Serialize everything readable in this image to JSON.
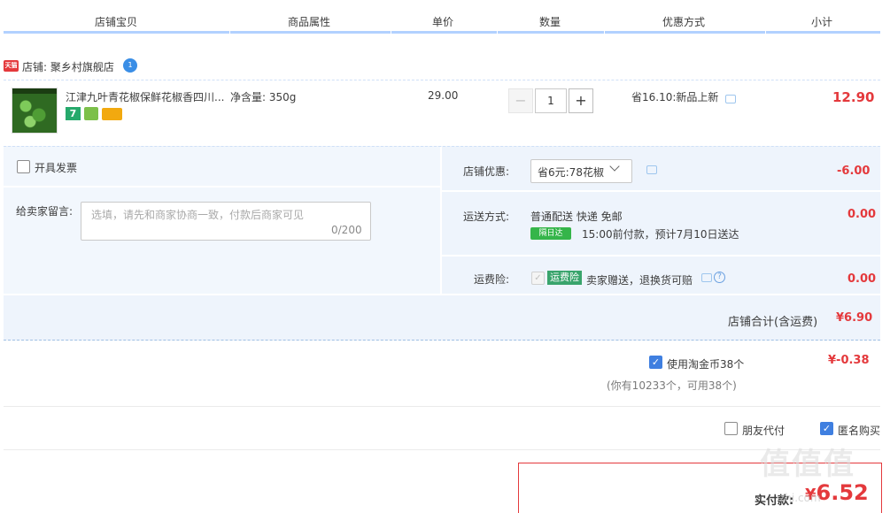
{
  "header": {
    "columns": [
      "店铺宝贝",
      "商品属性",
      "单价",
      "数量",
      "优惠方式",
      "小计"
    ]
  },
  "shop": {
    "badge": "天猫",
    "name": "店铺: 聚乡村旗舰店"
  },
  "item": {
    "title": "江津九叶青花椒保鲜花椒香四川...",
    "tag_seven": "7",
    "property": "净含量: 350g",
    "unit_price": "29.00",
    "quantity": "1",
    "minus": "−",
    "plus": "+",
    "promotion": "省16.10:新品上新",
    "subtotal": "12.90"
  },
  "invoice": {
    "label": "开具发票",
    "checked": false
  },
  "message": {
    "label": "给卖家留言:",
    "placeholder": "选填，请先和商家协商一致，付款后商家可见",
    "counter": "0/200"
  },
  "shop_discount": {
    "label": "店铺优惠:",
    "selected": "省6元:78花椒",
    "value": "-6.00"
  },
  "shipping": {
    "label": "运送方式:",
    "method": "普通配送 快递 免邮",
    "badge": "隔日达",
    "eta": "15:00前付款，预计7月10日送达",
    "value": "0.00"
  },
  "insurance": {
    "label": "运费险:",
    "tag": "运费险",
    "desc": "卖家赠送，退换货可赔",
    "value": "0.00"
  },
  "shop_total": {
    "label": "店铺合计(含运费)",
    "value": "¥6.90"
  },
  "coins": {
    "label": "使用淘金币38个",
    "note": "(你有10233个，可用38个)",
    "value": "¥-0.38",
    "checked": true
  },
  "options": {
    "friend_pay": "朋友代付",
    "anonymous": "匿名购买",
    "anonymous_checked": true
  },
  "payment": {
    "label": "实付款:",
    "currency": "¥",
    "value": "6.52"
  },
  "watermark": {
    "text": "值值值",
    "domain": "zhi.com"
  },
  "colors": {
    "accent_red": "#e4393c",
    "header_underline": "#b2d1ff",
    "panel_bg": "#eef4fc",
    "check_blue": "#3f7fe0",
    "green_tag": "#39a46c"
  }
}
